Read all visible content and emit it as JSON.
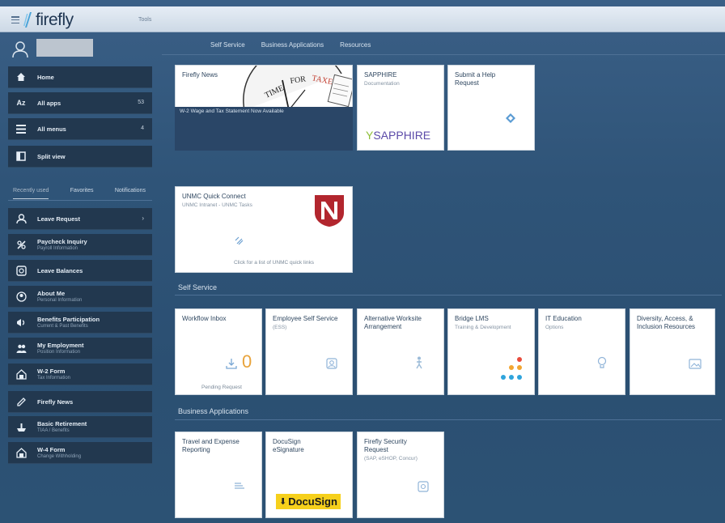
{
  "app": {
    "title": "firefly",
    "top_tab": "Tools"
  },
  "nav": {
    "tabs": [
      "Self Service",
      "Business Applications",
      "Resources"
    ]
  },
  "sidebar": {
    "main_items": [
      {
        "label": "Home",
        "icon": "home-icon"
      },
      {
        "label": "All apps",
        "badge": "53",
        "icon": "az-icon"
      },
      {
        "label": "All menus",
        "badge": "4",
        "icon": "list-icon"
      },
      {
        "label": "Split view",
        "icon": "split-view-icon"
      }
    ],
    "tabs": [
      "Recently used",
      "Favorites",
      "Notifications"
    ],
    "recent_items": [
      {
        "label": "Leave Request",
        "sub": "",
        "icon": "leave-request-icon"
      },
      {
        "label": "Paycheck Inquiry",
        "sub": "Payroll Information",
        "icon": "paycheck-icon"
      },
      {
        "label": "Leave Balances",
        "sub": "",
        "icon": "leave-balances-icon"
      },
      {
        "label": "About Me",
        "sub": "Personal Information",
        "icon": "person-icon"
      },
      {
        "label": "Benefits Participation",
        "sub": "Current & Past Benefits",
        "icon": "benefits-icon"
      },
      {
        "label": "My Employment",
        "sub": "Position Information",
        "icon": "employment-icon"
      },
      {
        "label": "W-2 Form",
        "sub": "Tax Information",
        "icon": "tax-form-icon"
      },
      {
        "label": "Firefly News",
        "sub": "",
        "icon": "news-icon"
      },
      {
        "label": "Basic Retirement",
        "sub": "TIAA / Benefits",
        "icon": "retirement-icon"
      },
      {
        "label": "W-4 Form",
        "sub": "Change Withholding",
        "icon": "w4-form-icon"
      }
    ]
  },
  "tiles": {
    "news": {
      "title": "Firefly News",
      "caption": "W-2 Wage and Tax Statement Now Available",
      "clock_text": "TIME FOR TAXES"
    },
    "sapphire": {
      "title": "SAPPHIRE",
      "sub": "Documentation",
      "logo_text": "SAPPHIRE"
    },
    "help": {
      "title": "Submit a Help Request"
    },
    "quick_connect": {
      "title": "UNMC Quick Connect",
      "sub": "UNMC Intranet - UNMC Tasks",
      "footer": "Click for a list of UNMC quick links"
    }
  },
  "sections": {
    "self_service": {
      "label": "Self Service",
      "tiles": [
        {
          "title": "Workflow Inbox",
          "sub": "",
          "count": "0",
          "footer": "Pending Request"
        },
        {
          "title": "Employee Self Service",
          "sub": "(ESS)"
        },
        {
          "title": "Alternative Worksite Arrangement",
          "sub": ""
        },
        {
          "title": "Bridge LMS",
          "sub": "Training & Development"
        },
        {
          "title": "IT Education",
          "sub": "Options"
        },
        {
          "title": "Diversity, Access, & Inclusion Resources",
          "sub": ""
        }
      ]
    },
    "business_apps": {
      "label": "Business Applications",
      "tiles": [
        {
          "title": "Travel and Expense Reporting",
          "sub": ""
        },
        {
          "title": "DocuSign eSignature",
          "sub": "",
          "logo_text": "DocuSign"
        },
        {
          "title": "Firefly Security Request",
          "sub": "(SAP, eSHOP, Concur)"
        }
      ]
    }
  }
}
